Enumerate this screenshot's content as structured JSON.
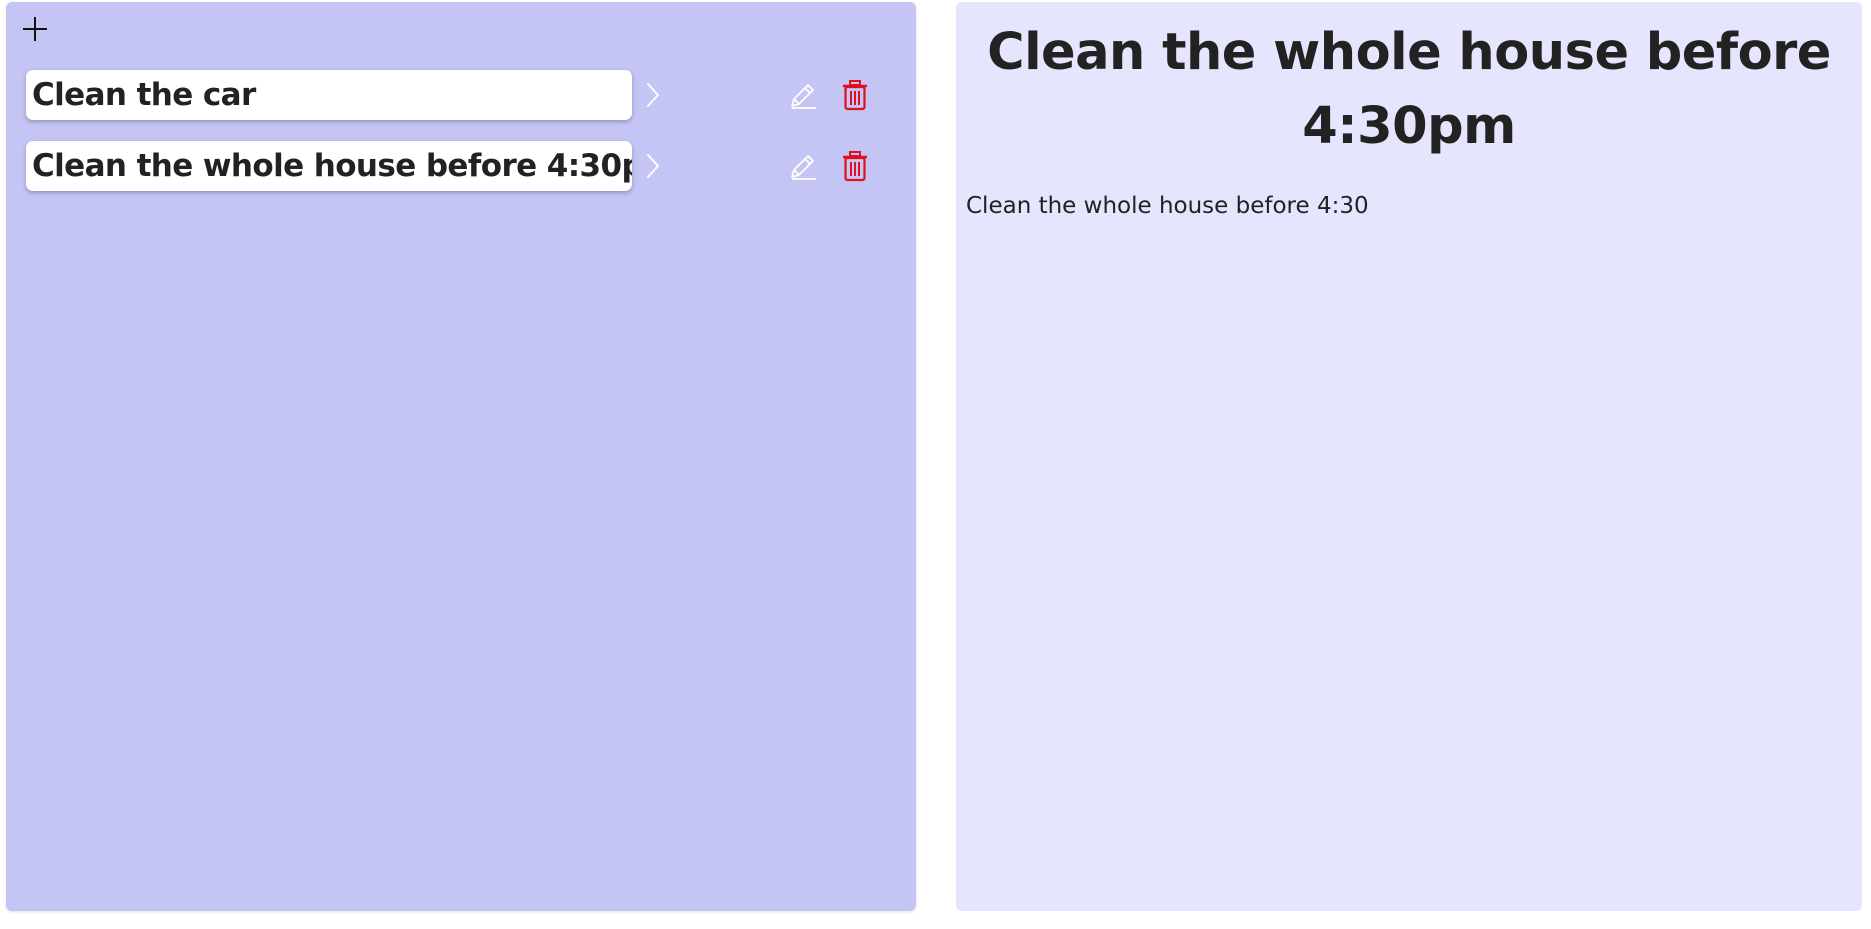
{
  "colors": {
    "left_panel_bg": "#c4c4f5",
    "right_panel_bg": "#e5e5fd",
    "delete_red": "#e0101e",
    "edit_icon": "#ffffff",
    "text": "#222222"
  },
  "toolbar": {
    "add_icon": "plus-icon"
  },
  "tasks": [
    {
      "title": "Clean the car",
      "open_icon": "chevron-right-icon",
      "edit_icon": "pencil-icon",
      "delete_icon": "trash-icon"
    },
    {
      "title": "Clean the whole house before 4:30pm",
      "open_icon": "chevron-right-icon",
      "edit_icon": "pencil-icon",
      "delete_icon": "trash-icon"
    }
  ],
  "detail": {
    "title": "Clean the whole house before 4:30pm",
    "description": "Clean the whole house before 4:30"
  }
}
